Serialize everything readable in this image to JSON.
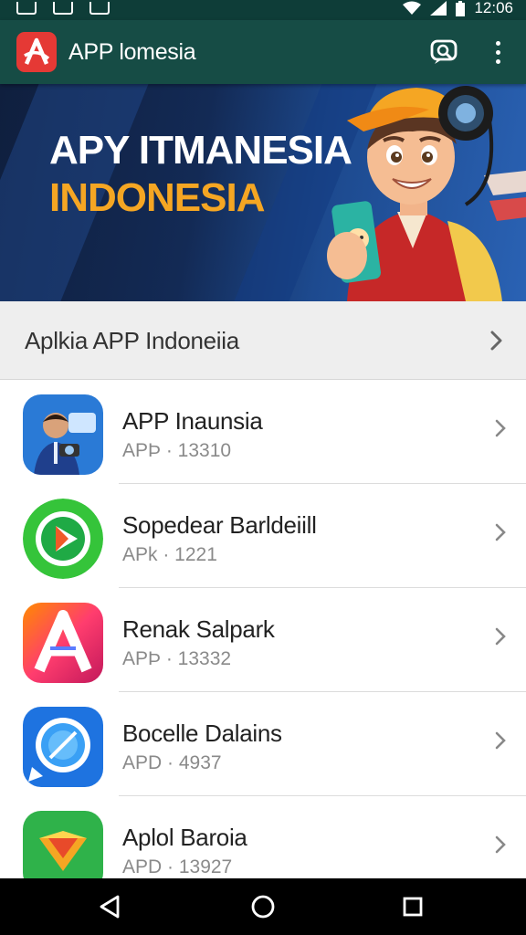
{
  "status_bar": {
    "time": "12:06",
    "icons": [
      "image-icon",
      "close-box-icon",
      "flash-icon",
      "wifi-icon",
      "signal-icon",
      "battery-icon"
    ]
  },
  "app_bar": {
    "title": "APP lomesia",
    "logo_icon": "app-logo-a-icon",
    "actions": [
      "search-chat-icon",
      "more-vert-icon"
    ]
  },
  "banner": {
    "line1": "APY ITMANESIA",
    "line2": "INDONESIA",
    "colors": {
      "line1": "#ffffff",
      "line2": "#f5a623"
    }
  },
  "section": {
    "title": "Aplkia APP Indoneiia"
  },
  "apps": [
    {
      "name": "APP Inaunsia",
      "meta": "APÞ · 13310",
      "icon": "person-camera-icon"
    },
    {
      "name": "Sopedear Barldeiill",
      "meta": "APk · 1221",
      "icon": "play-icon"
    },
    {
      "name": "Renak Salpark",
      "meta": "APÞ · 13332",
      "icon": "letter-a-icon"
    },
    {
      "name": "Bocelle Dalains",
      "meta": "APD · 4937",
      "icon": "compass-icon"
    },
    {
      "name": "Aplol Baroia",
      "meta": "APD · 13927",
      "icon": "arrow-down-icon"
    }
  ],
  "nav_bar": {
    "buttons": [
      "back-icon",
      "home-icon",
      "recents-icon"
    ]
  },
  "colors": {
    "app_bar": "#164c45",
    "status_bar": "#0e3d38",
    "accent": "#e53935"
  }
}
